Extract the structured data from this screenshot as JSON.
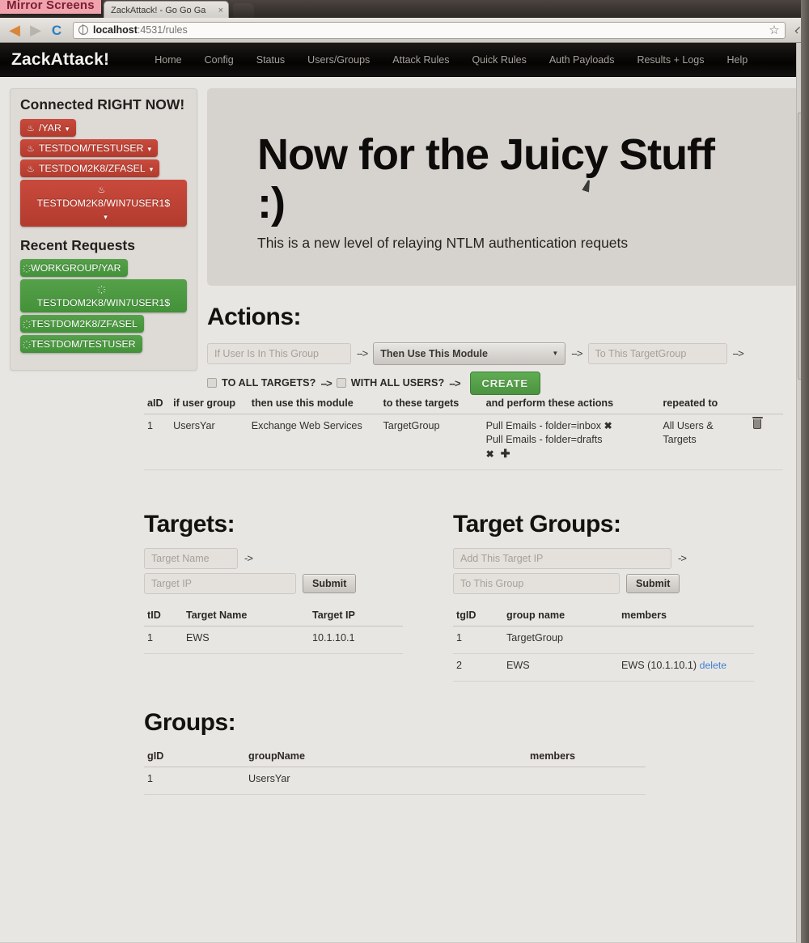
{
  "browser": {
    "mirror_badge": "Mirror Screens",
    "tab_title": "ZackAttack! - Go Go Ga",
    "tab_close": "×",
    "url_host": "localhost",
    "url_rest": ":4531/rules",
    "back_icon": "◀",
    "forward_icon": "▶",
    "reload_icon": "C",
    "star_icon": "☆",
    "wrench_icon": "⌐"
  },
  "appnav": {
    "brand": "ZackAttack!",
    "links": [
      "Home",
      "Config",
      "Status",
      "Users/Groups",
      "Attack Rules",
      "Quick Rules",
      "Auth Payloads",
      "Results + Logs",
      "Help"
    ]
  },
  "sidebar": {
    "connected_title": "Connected RIGHT NOW!",
    "connected": [
      {
        "label": "/YAR",
        "icon": "♨",
        "caret": "▾"
      },
      {
        "label": "TESTDOM/TESTUSER",
        "icon": "♨",
        "caret": "▾"
      },
      {
        "label": "TESTDOM2K8/ZFASEL",
        "icon": "♨",
        "caret": "▾"
      },
      {
        "label": "TESTDOM2K8/WIN7USER1$",
        "icon": "♨",
        "caret": "▾"
      }
    ],
    "recent_title": "Recent Requests",
    "recent": [
      {
        "label": "WORKGROUP/YAR",
        "icon": "҉"
      },
      {
        "label": "TESTDOM2K8/WIN7USER1$",
        "icon": "҉"
      },
      {
        "label": "TESTDOM2K8/ZFASEL",
        "icon": "҉"
      },
      {
        "label": "TESTDOM/TESTUSER",
        "icon": "҉"
      }
    ]
  },
  "hero": {
    "title": "Now for the Juicy Stuff :)",
    "subtitle": "This is a new level of relaying NTLM authentication requets"
  },
  "actions": {
    "heading": "Actions:",
    "group_placeholder": "If User Is In This Group",
    "module_selected": "Then Use This Module",
    "targetgroup_placeholder": "To This TargetGroup",
    "arrow": "-->",
    "all_targets_label": "TO ALL TARGETS?",
    "all_users_label": "WITH ALL USERS?",
    "create_label": "CREATE",
    "table": {
      "headers": [
        "aID",
        "if user group",
        "then use this module",
        "to these targets",
        "and perform these actions",
        "repeated to",
        ""
      ],
      "rows": [
        {
          "aid": "1",
          "group": "UsersYar",
          "module": "Exchange Web Services",
          "targets": "TargetGroup",
          "actions": [
            "Pull Emails - folder=inbox",
            "Pull Emails - folder=drafts"
          ],
          "action_x": "✖",
          "action_plus": "✚",
          "repeated": "All Users & Targets",
          "delete_icon": "trash-icon"
        }
      ]
    }
  },
  "targets": {
    "heading": "Targets:",
    "name_placeholder": "Target Name",
    "ip_placeholder": "Target IP",
    "arrow": "->",
    "submit_label": "Submit",
    "headers": [
      "tID",
      "Target Name",
      "Target IP"
    ],
    "rows": [
      {
        "tid": "1",
        "name": "EWS",
        "ip": "10.1.10.1"
      }
    ]
  },
  "target_groups": {
    "heading": "Target Groups:",
    "ip_placeholder": "Add This Target IP",
    "group_placeholder": "To This Group",
    "arrow": "->",
    "submit_label": "Submit",
    "headers": [
      "tgID",
      "group name",
      "members"
    ],
    "rows": [
      {
        "tgid": "1",
        "name": "TargetGroup",
        "members": "",
        "delete": ""
      },
      {
        "tgid": "2",
        "name": "EWS",
        "members": "EWS (10.1.10.1)",
        "delete": "delete"
      }
    ]
  },
  "groups": {
    "heading": "Groups:",
    "headers": [
      "gID",
      "groupName",
      "members"
    ],
    "rows": [
      {
        "gid": "1",
        "name": "UsersYar",
        "members": ""
      }
    ]
  },
  "colors": {
    "brand_bar": "#0a0908",
    "badge_red": "#c2443a",
    "badge_green": "#4a9b40",
    "create_green": "#4c9340",
    "link_blue": "#3f7fd0"
  }
}
